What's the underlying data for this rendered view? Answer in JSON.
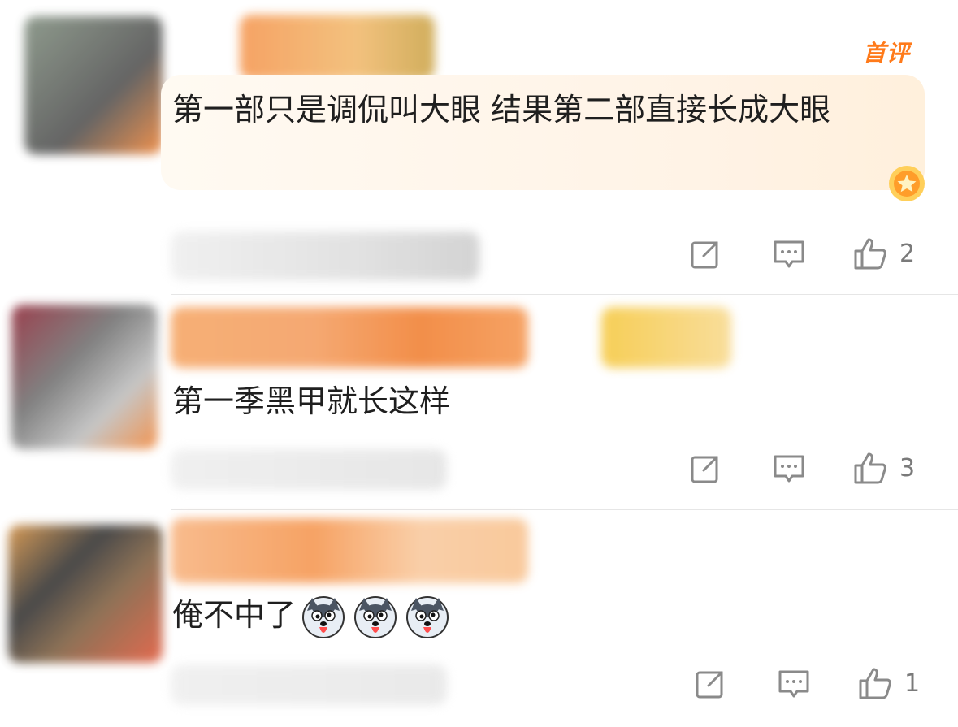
{
  "comments": [
    {
      "badge": "首评",
      "text": "第一部只是调侃叫大眼 结果第二部直接长成大眼",
      "like_count": "2"
    },
    {
      "text": "第一季黑甲就长这样",
      "like_count": "3"
    },
    {
      "text": "俺不中了",
      "emoji_icon": "husky-dog-emoji",
      "emoji_count": 3,
      "like_count": "1"
    }
  ],
  "icons": {
    "share": "share-square-icon",
    "reply": "comment-bubble-icon",
    "like": "thumbs-up-icon",
    "medal": "gold-star-medal-icon"
  },
  "colors": {
    "accent": "#ff7a1a",
    "icon": "#8a8a8a",
    "text": "#1f1f1f"
  }
}
